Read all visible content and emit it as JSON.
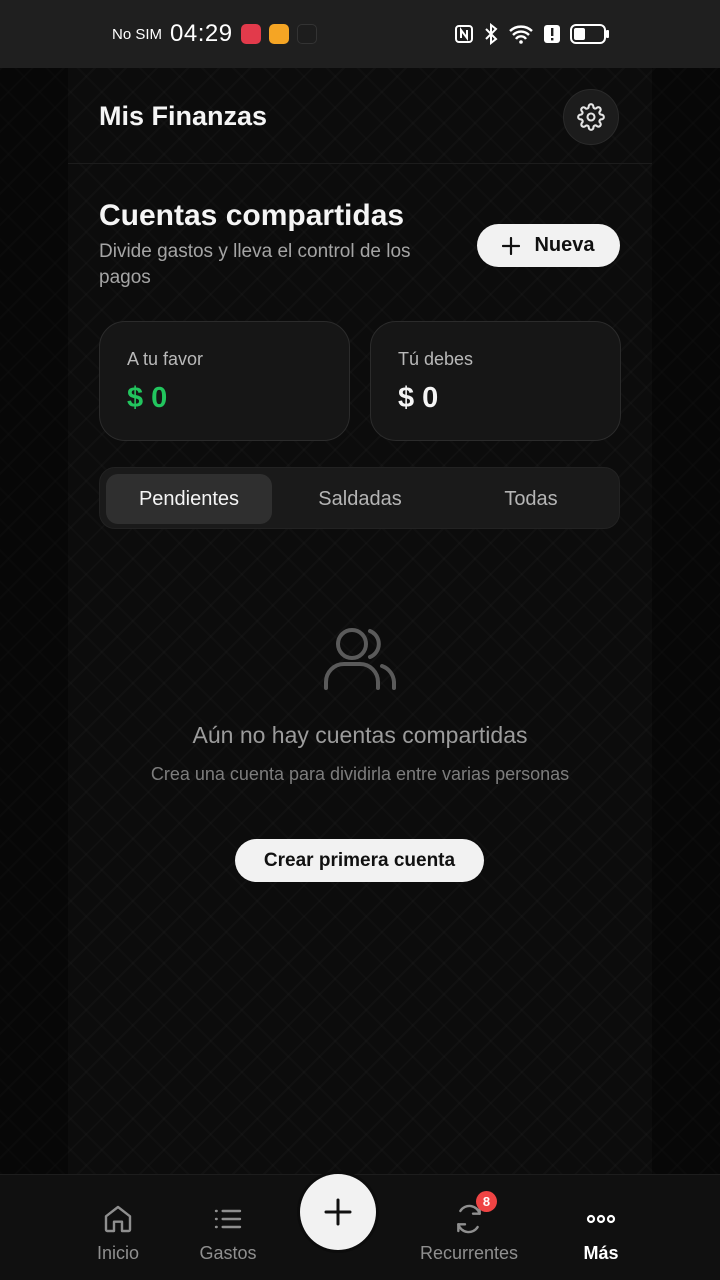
{
  "status_bar": {
    "carrier": "No SIM",
    "time": "04:29",
    "battery_level": 0.35
  },
  "header": {
    "title": "Mis Finanzas"
  },
  "section": {
    "title": "Cuentas compartidas",
    "subtitle": "Divide gastos y lleva el control de los pagos",
    "new_button_label": "Nueva"
  },
  "balances": {
    "favor": {
      "label": "A tu favor",
      "value": "$ 0",
      "color": "#22c55e"
    },
    "debes": {
      "label": "Tú debes",
      "value": "$ 0"
    }
  },
  "tabs": [
    {
      "label": "Pendientes",
      "active": true
    },
    {
      "label": "Saldadas",
      "active": false
    },
    {
      "label": "Todas",
      "active": false
    }
  ],
  "empty_state": {
    "icon": "users-icon",
    "title": "Aún no hay cuentas compartidas",
    "description": "Crea una cuenta para dividirla entre varias personas",
    "button_label": "Crear primera cuenta"
  },
  "bottom_nav": {
    "items": [
      {
        "label": "Inicio",
        "icon": "home-icon"
      },
      {
        "label": "Gastos",
        "icon": "list-icon"
      },
      {
        "label": "Recurrentes",
        "icon": "refresh-icon",
        "badge": "8"
      },
      {
        "label": "Más",
        "icon": "more-icon",
        "active": true
      }
    ],
    "fab_icon": "plus-icon"
  },
  "colors": {
    "accent_positive": "#22c55e",
    "badge": "#ef4444",
    "background": "#0c0c0c"
  }
}
